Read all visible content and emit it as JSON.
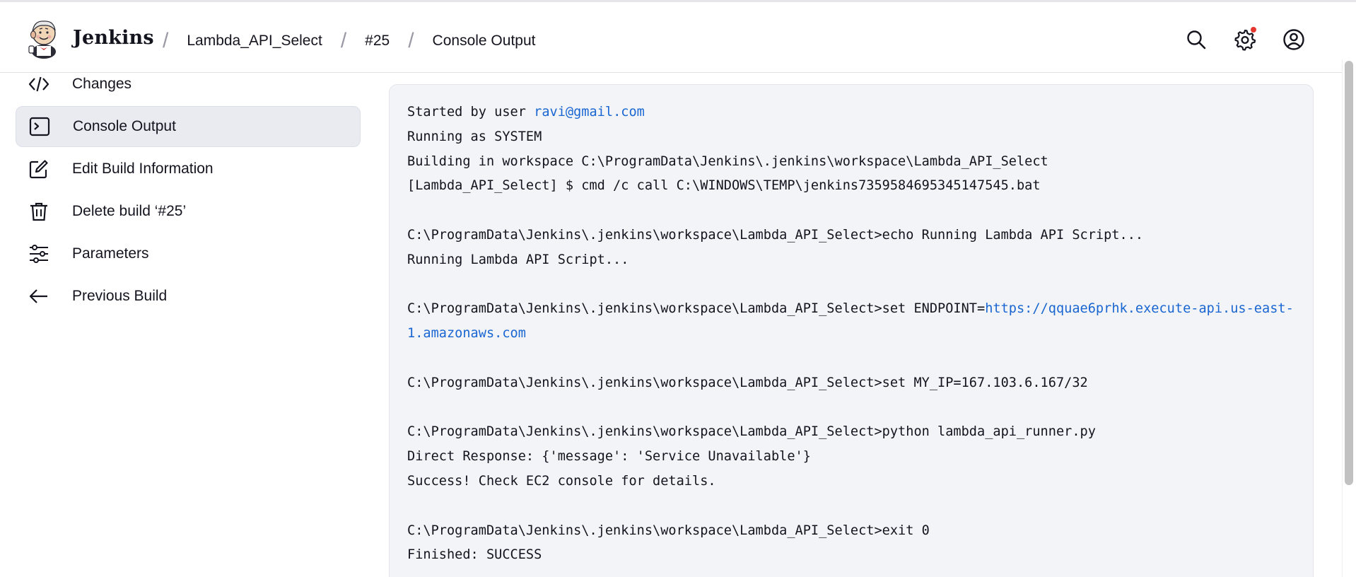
{
  "header": {
    "brand": "Jenkins",
    "breadcrumbs": [
      "Lambda_API_Select",
      "#25",
      "Console Output"
    ],
    "icons": [
      "search-icon",
      "settings-icon",
      "user-icon"
    ],
    "notification_color": "#e6372e"
  },
  "sidebar": {
    "items": [
      {
        "label": "Changes",
        "icon": "code-icon",
        "active": false
      },
      {
        "label": "Console Output",
        "icon": "terminal-icon",
        "active": true
      },
      {
        "label": "Edit Build Information",
        "icon": "edit-icon",
        "active": false
      },
      {
        "label": "Delete build ‘#25’",
        "icon": "trash-icon",
        "active": false
      },
      {
        "label": "Parameters",
        "icon": "sliders-icon",
        "active": false
      },
      {
        "label": "Previous Build",
        "icon": "arrow-left-icon",
        "active": false
      }
    ]
  },
  "console": {
    "started_prefix": "Started by user ",
    "started_user": "ravi@gmail.com",
    "running_as": "Running as SYSTEM",
    "building_in": "Building in workspace C:\\ProgramData\\Jenkins\\.jenkins\\workspace\\Lambda_API_Select",
    "cmd_call": "[Lambda_API_Select] $ cmd /c call C:\\WINDOWS\\TEMP\\jenkins7359584695345147545.bat",
    "echo_cmd": "C:\\ProgramData\\Jenkins\\.jenkins\\workspace\\Lambda_API_Select>echo Running Lambda API Script...",
    "echo_out": "Running Lambda API Script...",
    "set_endpoint_prefix": "C:\\ProgramData\\Jenkins\\.jenkins\\workspace\\Lambda_API_Select>set ENDPOINT=",
    "endpoint_url": "https://qquae6prhk.execute-api.us-east-1.amazonaws.com",
    "set_ip": "C:\\ProgramData\\Jenkins\\.jenkins\\workspace\\Lambda_API_Select>set MY_IP=167.103.6.167/32",
    "python_cmd": "C:\\ProgramData\\Jenkins\\.jenkins\\workspace\\Lambda_API_Select>python lambda_api_runner.py",
    "direct_response": "Direct Response: {'message': 'Service Unavailable'}",
    "success_msg": "Success! Check EC2 console for details.",
    "exit_cmd": "C:\\ProgramData\\Jenkins\\.jenkins\\workspace\\Lambda_API_Select>exit 0",
    "finished": "Finished: SUCCESS"
  },
  "colors": {
    "link": "#1966d2",
    "console_bg": "#f2f4f7",
    "active_item_bg": "#e9ebf1"
  }
}
